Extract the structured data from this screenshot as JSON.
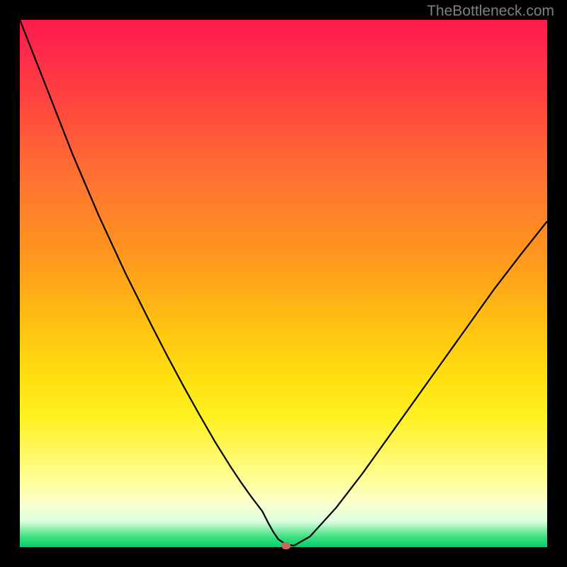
{
  "watermark": "TheBottleneck.com",
  "chart_data": {
    "type": "line",
    "title": "",
    "xlabel": "",
    "ylabel": "",
    "x": [
      0.0,
      0.05,
      0.1,
      0.15,
      0.2,
      0.25,
      0.28,
      0.31,
      0.34,
      0.37,
      0.4,
      0.42,
      0.44,
      0.46,
      0.47,
      0.48,
      0.49,
      0.505,
      0.52,
      0.55,
      0.6,
      0.65,
      0.7,
      0.75,
      0.8,
      0.85,
      0.9,
      0.95,
      1.0
    ],
    "y": [
      1.0,
      0.873,
      0.745,
      0.628,
      0.52,
      0.42,
      0.362,
      0.306,
      0.252,
      0.2,
      0.152,
      0.122,
      0.094,
      0.068,
      0.048,
      0.03,
      0.015,
      0.005,
      0.003,
      0.02,
      0.075,
      0.14,
      0.21,
      0.28,
      0.35,
      0.42,
      0.49,
      0.555,
      0.618
    ],
    "xlim": [
      0,
      1
    ],
    "ylim": [
      0,
      1
    ],
    "marker": {
      "x": 0.505,
      "y": 0.003
    },
    "background_gradient": {
      "top": "#ff1a4a",
      "mid": "#ffe010",
      "bottom": "#00d070"
    }
  }
}
